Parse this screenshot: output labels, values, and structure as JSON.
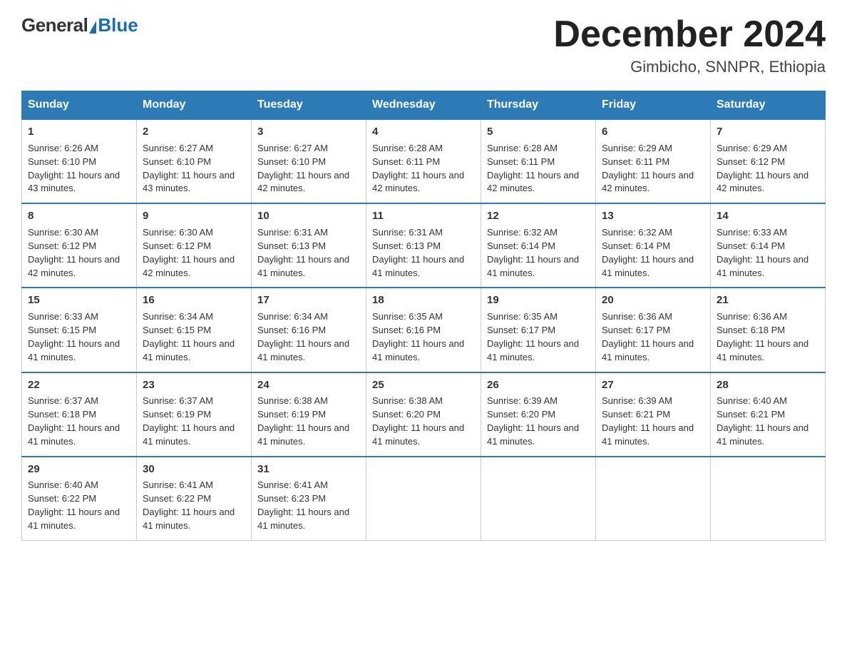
{
  "logo": {
    "general": "General",
    "blue": "Blue",
    "subtitle": ""
  },
  "title": {
    "month_year": "December 2024",
    "location": "Gimbicho, SNNPR, Ethiopia"
  },
  "days_header": [
    "Sunday",
    "Monday",
    "Tuesday",
    "Wednesday",
    "Thursday",
    "Friday",
    "Saturday"
  ],
  "weeks": [
    [
      {
        "day": 1,
        "sunrise": "6:26 AM",
        "sunset": "6:10 PM",
        "daylight": "11 hours and 43 minutes."
      },
      {
        "day": 2,
        "sunrise": "6:27 AM",
        "sunset": "6:10 PM",
        "daylight": "11 hours and 43 minutes."
      },
      {
        "day": 3,
        "sunrise": "6:27 AM",
        "sunset": "6:10 PM",
        "daylight": "11 hours and 42 minutes."
      },
      {
        "day": 4,
        "sunrise": "6:28 AM",
        "sunset": "6:11 PM",
        "daylight": "11 hours and 42 minutes."
      },
      {
        "day": 5,
        "sunrise": "6:28 AM",
        "sunset": "6:11 PM",
        "daylight": "11 hours and 42 minutes."
      },
      {
        "day": 6,
        "sunrise": "6:29 AM",
        "sunset": "6:11 PM",
        "daylight": "11 hours and 42 minutes."
      },
      {
        "day": 7,
        "sunrise": "6:29 AM",
        "sunset": "6:12 PM",
        "daylight": "11 hours and 42 minutes."
      }
    ],
    [
      {
        "day": 8,
        "sunrise": "6:30 AM",
        "sunset": "6:12 PM",
        "daylight": "11 hours and 42 minutes."
      },
      {
        "day": 9,
        "sunrise": "6:30 AM",
        "sunset": "6:12 PM",
        "daylight": "11 hours and 42 minutes."
      },
      {
        "day": 10,
        "sunrise": "6:31 AM",
        "sunset": "6:13 PM",
        "daylight": "11 hours and 41 minutes."
      },
      {
        "day": 11,
        "sunrise": "6:31 AM",
        "sunset": "6:13 PM",
        "daylight": "11 hours and 41 minutes."
      },
      {
        "day": 12,
        "sunrise": "6:32 AM",
        "sunset": "6:14 PM",
        "daylight": "11 hours and 41 minutes."
      },
      {
        "day": 13,
        "sunrise": "6:32 AM",
        "sunset": "6:14 PM",
        "daylight": "11 hours and 41 minutes."
      },
      {
        "day": 14,
        "sunrise": "6:33 AM",
        "sunset": "6:14 PM",
        "daylight": "11 hours and 41 minutes."
      }
    ],
    [
      {
        "day": 15,
        "sunrise": "6:33 AM",
        "sunset": "6:15 PM",
        "daylight": "11 hours and 41 minutes."
      },
      {
        "day": 16,
        "sunrise": "6:34 AM",
        "sunset": "6:15 PM",
        "daylight": "11 hours and 41 minutes."
      },
      {
        "day": 17,
        "sunrise": "6:34 AM",
        "sunset": "6:16 PM",
        "daylight": "11 hours and 41 minutes."
      },
      {
        "day": 18,
        "sunrise": "6:35 AM",
        "sunset": "6:16 PM",
        "daylight": "11 hours and 41 minutes."
      },
      {
        "day": 19,
        "sunrise": "6:35 AM",
        "sunset": "6:17 PM",
        "daylight": "11 hours and 41 minutes."
      },
      {
        "day": 20,
        "sunrise": "6:36 AM",
        "sunset": "6:17 PM",
        "daylight": "11 hours and 41 minutes."
      },
      {
        "day": 21,
        "sunrise": "6:36 AM",
        "sunset": "6:18 PM",
        "daylight": "11 hours and 41 minutes."
      }
    ],
    [
      {
        "day": 22,
        "sunrise": "6:37 AM",
        "sunset": "6:18 PM",
        "daylight": "11 hours and 41 minutes."
      },
      {
        "day": 23,
        "sunrise": "6:37 AM",
        "sunset": "6:19 PM",
        "daylight": "11 hours and 41 minutes."
      },
      {
        "day": 24,
        "sunrise": "6:38 AM",
        "sunset": "6:19 PM",
        "daylight": "11 hours and 41 minutes."
      },
      {
        "day": 25,
        "sunrise": "6:38 AM",
        "sunset": "6:20 PM",
        "daylight": "11 hours and 41 minutes."
      },
      {
        "day": 26,
        "sunrise": "6:39 AM",
        "sunset": "6:20 PM",
        "daylight": "11 hours and 41 minutes."
      },
      {
        "day": 27,
        "sunrise": "6:39 AM",
        "sunset": "6:21 PM",
        "daylight": "11 hours and 41 minutes."
      },
      {
        "day": 28,
        "sunrise": "6:40 AM",
        "sunset": "6:21 PM",
        "daylight": "11 hours and 41 minutes."
      }
    ],
    [
      {
        "day": 29,
        "sunrise": "6:40 AM",
        "sunset": "6:22 PM",
        "daylight": "11 hours and 41 minutes."
      },
      {
        "day": 30,
        "sunrise": "6:41 AM",
        "sunset": "6:22 PM",
        "daylight": "11 hours and 41 minutes."
      },
      {
        "day": 31,
        "sunrise": "6:41 AM",
        "sunset": "6:23 PM",
        "daylight": "11 hours and 41 minutes."
      },
      null,
      null,
      null,
      null
    ]
  ]
}
